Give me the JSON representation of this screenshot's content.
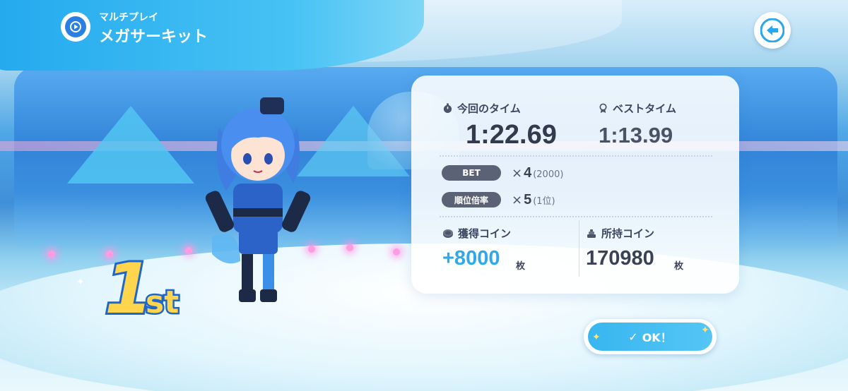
{
  "header": {
    "category": "マルチプレイ",
    "title": "メガサーキット"
  },
  "rank": {
    "number": "1",
    "suffix": "st"
  },
  "result": {
    "current_time_label": "今回のタイム",
    "current_time": "1:22.69",
    "best_time_label": "ベストタイム",
    "best_time": "1:13.99",
    "bet": {
      "label": "BET",
      "x": "×",
      "multiplier": "4",
      "detail": "(2000)"
    },
    "rank_multiplier": {
      "label": "順位倍率",
      "x": "×",
      "multiplier": "5",
      "detail": "(1位)"
    },
    "earned_coins_label": "獲得コイン",
    "earned_coins": "+8000",
    "owned_coins_label": "所持コイン",
    "owned_coins": "170980",
    "unit": "枚"
  },
  "ok_button": {
    "check": "✓",
    "label": "OK！"
  },
  "colors": {
    "accent": "#2fb3ef",
    "earned": "#2fa9ea",
    "rank_gold": "#ffd54d",
    "rank_outline": "#1f66c9"
  },
  "icons": {
    "mode": "play-circle-icon",
    "back": "back-arrow-icon",
    "current_time": "stopwatch-icon",
    "best_time": "medal-icon",
    "earned_coins": "coin-icon",
    "owned_coins": "coin-stack-icon"
  }
}
